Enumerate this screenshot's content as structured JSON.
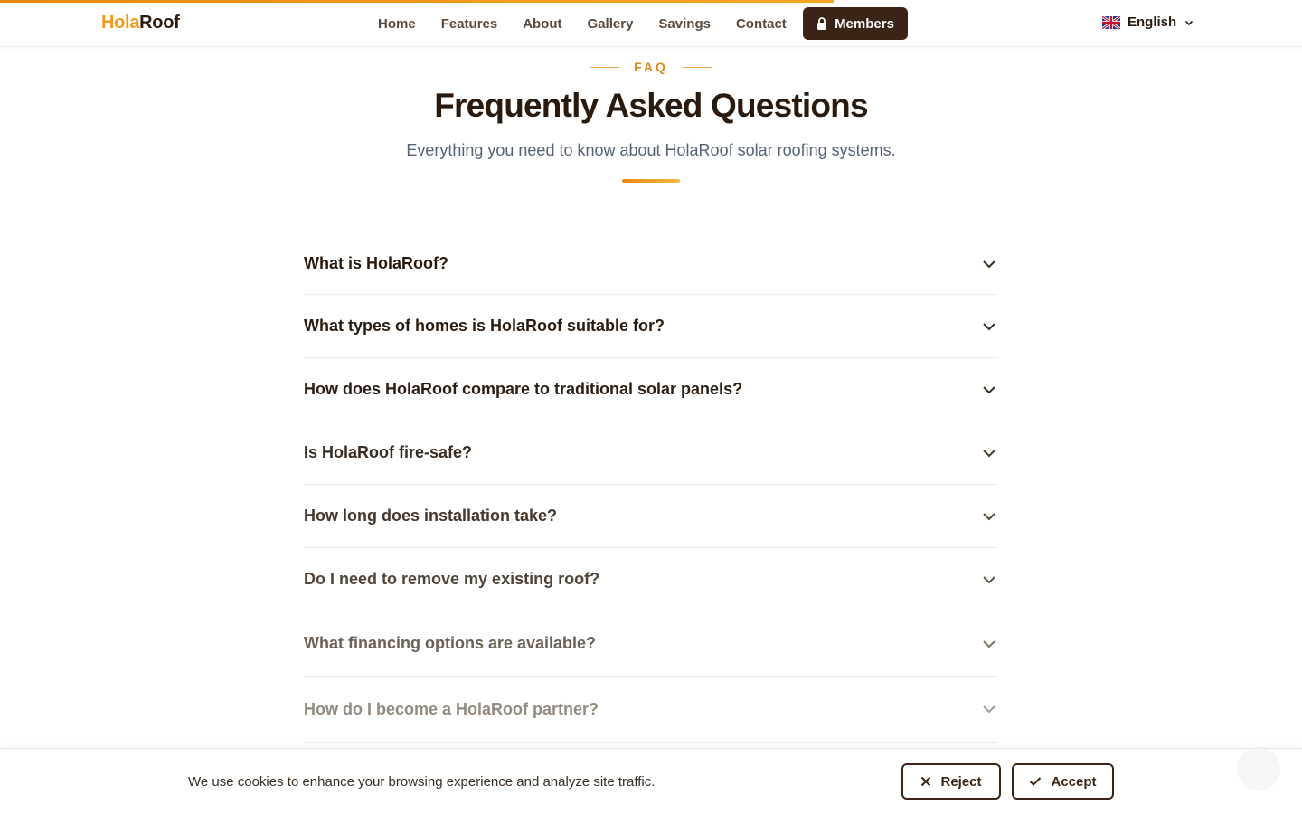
{
  "brand": {
    "part1": "Hola",
    "part2": "Roof"
  },
  "nav": {
    "items": [
      "Home",
      "Features",
      "About",
      "Gallery",
      "Savings",
      "Contact"
    ],
    "members_label": "Members"
  },
  "language": {
    "label": "English",
    "flag_icon": "uk-flag-icon"
  },
  "scroll_progress": 0.64,
  "faq": {
    "kicker": "FAQ",
    "title": "Frequently Asked Questions",
    "subtitle": "Everything you need to know about HolaRoof solar roofing systems.",
    "items": [
      "What is HolaRoof?",
      "What types of homes is HolaRoof suitable for?",
      "How does HolaRoof compare to traditional solar panels?",
      "Is HolaRoof fire-safe?",
      "How long does installation take?",
      "Do I need to remove my existing roof?",
      "What financing options are available?",
      "How do I become a HolaRoof partner?"
    ]
  },
  "cookie": {
    "text": "We use cookies to enhance your browsing experience and analyze site traffic.",
    "reject_label": "Reject",
    "accept_label": "Accept"
  },
  "colors": {
    "accent": "#f29a1a",
    "brand_dark": "#3a2415",
    "title": "#2a1a0e",
    "subtitle": "#55627a"
  }
}
